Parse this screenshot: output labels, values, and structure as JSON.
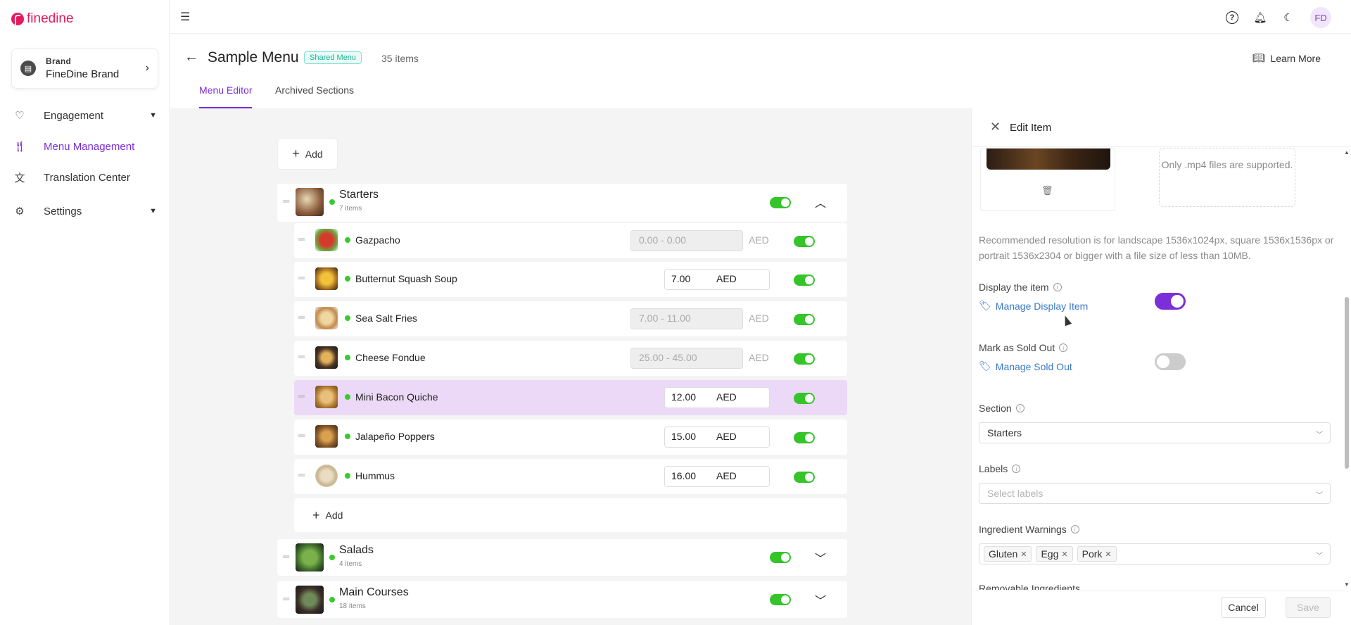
{
  "app": {
    "logo_text": "finedine",
    "brand_color": "#e5195f",
    "accent_color": "#7b2fd8"
  },
  "brand": {
    "label": "Brand",
    "name": "FineDine Brand"
  },
  "sidebar": {
    "items": [
      {
        "label": "Engagement",
        "icon": "heart-icon",
        "expandable": true
      },
      {
        "label": "Menu Management",
        "icon": "fork-knife-icon",
        "active": true
      },
      {
        "label": "Translation Center",
        "icon": "translate-icon"
      },
      {
        "label": "Settings",
        "icon": "gear-icon",
        "expandable": true
      }
    ]
  },
  "topbar": {
    "avatar_initials": "FD",
    "icons": [
      "menu-toggle-icon",
      "help-icon",
      "bell-icon",
      "moon-icon"
    ]
  },
  "header": {
    "title": "Sample Menu",
    "badge": "Shared Menu",
    "item_count": "35 items",
    "learn_more": "Learn More",
    "tabs": [
      {
        "label": "Menu Editor",
        "active": true
      },
      {
        "label": "Archived Sections"
      }
    ]
  },
  "editor": {
    "add_label": "Add",
    "sections": [
      {
        "name": "Starters",
        "count": "7 items",
        "enabled": true,
        "expanded": true,
        "items": [
          {
            "name": "Gazpacho",
            "price": "0.00 - 0.00",
            "currency": "AED",
            "disabled_price": true,
            "enabled": true
          },
          {
            "name": "Butternut Squash Soup",
            "price": "7.00",
            "currency": "AED",
            "disabled_price": false,
            "enabled": true
          },
          {
            "name": "Sea Salt Fries",
            "price": "7.00 - 11.00",
            "currency": "AED",
            "disabled_price": true,
            "enabled": true
          },
          {
            "name": "Cheese Fondue",
            "price": "25.00 - 45.00",
            "currency": "AED",
            "disabled_price": true,
            "enabled": true
          },
          {
            "name": "Mini Bacon Quiche",
            "price": "12.00",
            "currency": "AED",
            "disabled_price": false,
            "enabled": true,
            "selected": true
          },
          {
            "name": "Jalapeño Poppers",
            "price": "15.00",
            "currency": "AED",
            "disabled_price": false,
            "enabled": true
          },
          {
            "name": "Hummus",
            "price": "16.00",
            "currency": "AED",
            "disabled_price": false,
            "enabled": true
          }
        ],
        "add_label": "Add"
      },
      {
        "name": "Salads",
        "count": "4 items",
        "enabled": true,
        "expanded": false
      },
      {
        "name": "Main Courses",
        "count": "18 items",
        "enabled": true,
        "expanded": false
      }
    ]
  },
  "edit_panel": {
    "title": "Edit Item",
    "video_hint": "Only .mp4 files are supported.",
    "resolution_hint": "Recommended resolution is for landscape 1536x1024px, square 1536x1536px or portrait 1536x2304 or bigger with a file size of less than 10MB.",
    "display_item": {
      "label": "Display the item",
      "link": "Manage Display Item",
      "on": true
    },
    "sold_out": {
      "label": "Mark as Sold Out",
      "link": "Manage Sold Out",
      "on": false
    },
    "section": {
      "label": "Section",
      "value": "Starters"
    },
    "labels": {
      "label": "Labels",
      "placeholder": "Select labels"
    },
    "ingredient_warnings": {
      "label": "Ingredient Warnings",
      "chips": [
        "Gluten",
        "Egg",
        "Pork"
      ]
    },
    "removable_ingredients": {
      "label": "Removable Ingredients"
    },
    "cancel": "Cancel",
    "save": "Save"
  }
}
